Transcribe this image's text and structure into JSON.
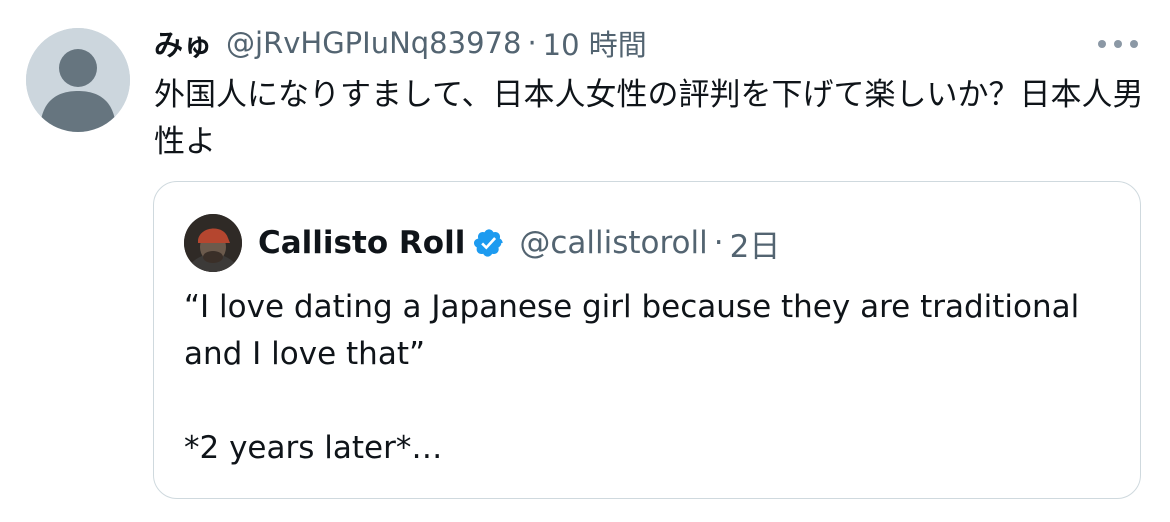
{
  "tweet": {
    "display_name": "みゅ",
    "handle": "@jRvHGPIuNq83978",
    "separator": "·",
    "time": "10 時間",
    "text": "外国人になりすまして、日本人女性の評判を下げて楽しいか？日本人男性よ",
    "avatar_icon": "default-avatar-icon",
    "more_icon": "more-dots-icon"
  },
  "quote": {
    "display_name": "Callisto Roll",
    "verified_icon": "verified-badge-icon",
    "handle": "@callistoroll",
    "separator": "·",
    "time": "2日",
    "text": "“I love dating a Japanese girl because they are traditional and I love that”\n\n*2 years later*…"
  },
  "colors": {
    "text_primary": "#0f1419",
    "text_secondary": "#536471",
    "border": "#cfd9de",
    "verified": "#1d9bf0",
    "avatar_bg": "#ccd6dd",
    "avatar_fg": "#66757f"
  }
}
